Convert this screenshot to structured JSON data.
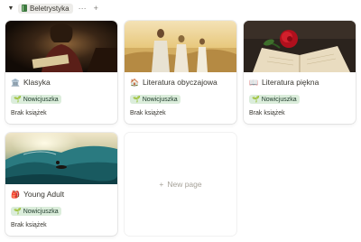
{
  "group": {
    "toggle_icon": "triangle-down",
    "name": "Beletrystyka",
    "more_label": "···",
    "add_label": "+"
  },
  "cards": [
    {
      "title": "Klasyka",
      "icon": "classical-building-icon",
      "emoji": "🏛️",
      "tag": "Nowicjuszka",
      "status": "Brak książek"
    },
    {
      "title": "Literatura obyczajowa",
      "icon": "house-icon",
      "emoji": "🏠",
      "tag": "Nowicjuszka",
      "status": "Brak książek"
    },
    {
      "title": "Literatura piękna",
      "icon": "open-book-icon",
      "emoji": "📖",
      "tag": "Nowicjuszka",
      "status": "Brak książek"
    },
    {
      "title": "Young Adult",
      "icon": "backpack-icon",
      "emoji": "🎒",
      "tag": "Nowicjuszka",
      "status": "Brak książek"
    }
  ],
  "new_page": {
    "plus": "+",
    "label": "New page"
  }
}
